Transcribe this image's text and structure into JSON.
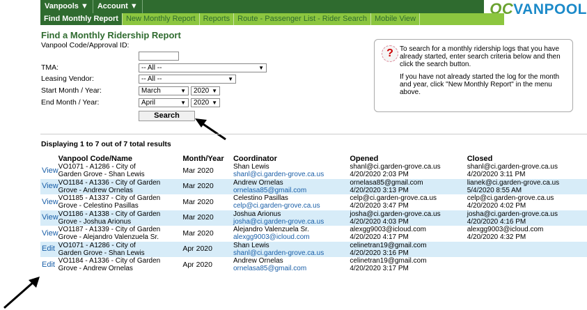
{
  "topmenu": {
    "vanpools": "Vanpools ▼",
    "account": "Account ▼"
  },
  "logo": {
    "oc": "OC",
    "rest": "VANPOOL"
  },
  "tabs": [
    "Find Monthly Report",
    "New Monthly Report",
    "Reports",
    "Route - Passenger List - Rider Search",
    "Mobile View"
  ],
  "form": {
    "title": "Find a Monthly Ridership Report",
    "code_label": "Vanpool Code/Approval ID:",
    "code_value": "",
    "tma_label": "TMA:",
    "tma_value": "-- All --",
    "vendor_label": "Leasing Vendor:",
    "vendor_value": "-- All --",
    "start_label": "Start Month / Year:",
    "start_month": "March",
    "start_year": "2020",
    "end_label": "End Month / Year:",
    "end_month": "April",
    "end_year": "2020",
    "search_label": "Search"
  },
  "help": {
    "icon": "?",
    "p1": "To search for a monthly ridership logs that you have already started, enter search criteria below and then click the search button.",
    "p2": "If you have not already started the log for the month and year, click \"New Monthly Report\" in the menu above."
  },
  "results_text": "Displaying 1 to 7 out of 7 total results",
  "columns": [
    "",
    "Vanpool Code/Name",
    "Month/Year",
    "Coordinator",
    "Opened",
    "Closed"
  ],
  "rows": [
    {
      "action": "View",
      "name1": "VO1071 - A1286 - City of",
      "name2": "Garden Grove - Shan Lewis",
      "month": "Mar 2020",
      "coord": "Shan Lewis",
      "coord_email": "shanl@ci.garden-grove.ca.us",
      "opened1": "shanl@ci.garden-grove.ca.us",
      "opened2": "4/20/2020 2:03 PM",
      "closed1": "shanl@ci.garden-grove.ca.us",
      "closed2": "4/20/2020 3:11 PM"
    },
    {
      "action": "View",
      "name1": "VO1184 - A1336 - City of Garden",
      "name2": "Grove - Andrew Ornelas",
      "month": "Mar 2020",
      "coord": "Andrew Ornelas",
      "coord_email": "ornelasa85@gmail.com",
      "opened1": "ornelasa85@gmail.com",
      "opened2": "4/20/2020 3:13 PM",
      "closed1": "lianek@ci.garden-grove.ca.us",
      "closed2": "5/4/2020 8:55 AM"
    },
    {
      "action": "View",
      "name1": "VO1185 - A1337 - City of Garden",
      "name2": "Grove - Celestino Pasillas",
      "month": "Mar 2020",
      "coord": "Celestino Pasillas",
      "coord_email": "celp@ci.garden-grove.ca.us",
      "opened1": "celp@ci.garden-grove.ca.us",
      "opened2": "4/20/2020 3:47 PM",
      "closed1": "celp@ci.garden-grove.ca.us",
      "closed2": "4/20/2020 4:02 PM"
    },
    {
      "action": "View",
      "name1": "VO1186 - A1338 - City of Garden",
      "name2": "Grove - Joshua Arionus",
      "month": "Mar 2020",
      "coord": "Joshua Arionus",
      "coord_email": "josha@ci.garden-grove.ca.us",
      "opened1": "josha@ci.garden-grove.ca.us",
      "opened2": "4/20/2020 4:03 PM",
      "closed1": "josha@ci.garden-grove.ca.us",
      "closed2": "4/20/2020 4:16 PM"
    },
    {
      "action": "View",
      "name1": "VO1187 - A1339 - City of Garden",
      "name2": "Grove - Alejandro Valenzuela Sr.",
      "month": "Mar 2020",
      "coord": "Alejandro Valenzuela Sr.",
      "coord_email": "alexgg9003@icloud.com",
      "opened1": "alexgg9003@icloud.com",
      "opened2": "4/20/2020 4:17 PM",
      "closed1": "alexgg9003@icloud.com",
      "closed2": "4/20/2020 4:32 PM"
    },
    {
      "action": "Edit",
      "name1": "VO1071 - A1286 - City of",
      "name2": "Garden Grove - Shan Lewis",
      "month": "Apr 2020",
      "coord": "Shan Lewis",
      "coord_email": "shanl@ci.garden-grove.ca.us",
      "opened1": "celinetran19@gmail.com",
      "opened2": "4/20/2020 3:16 PM",
      "closed1": "",
      "closed2": ""
    },
    {
      "action": "Edit",
      "name1": "VO1184 - A1336 - City of Garden",
      "name2": "Grove - Andrew Ornelas",
      "month": "Apr 2020",
      "coord": "Andrew Ornelas",
      "coord_email": "ornelasa85@gmail.com",
      "opened1": "celinetran19@gmail.com",
      "opened2": "4/20/2020 3:17 PM",
      "closed1": "",
      "closed2": ""
    }
  ]
}
